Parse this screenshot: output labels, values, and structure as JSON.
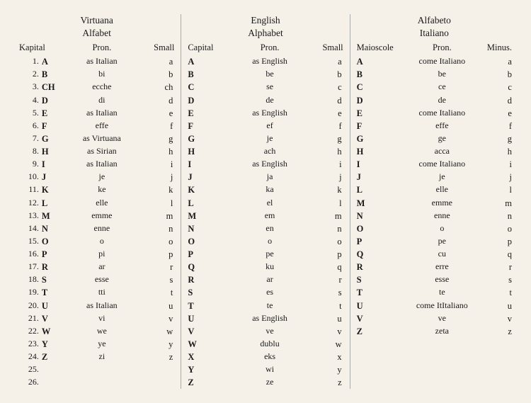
{
  "virtuana": {
    "title1": "Virtuana",
    "title2": "Alfabet",
    "headers": [
      "Kapital",
      "Pron.",
      "Small"
    ],
    "rows": [
      [
        "1.",
        "A",
        "as Italian",
        "a"
      ],
      [
        "2.",
        "B",
        "bi",
        "b"
      ],
      [
        "3.",
        "CH",
        "ecche",
        "ch"
      ],
      [
        "4.",
        "D",
        "di",
        "d"
      ],
      [
        "5.",
        "E",
        "as Italian",
        "e"
      ],
      [
        "6.",
        "F",
        "effe",
        "f"
      ],
      [
        "7.",
        "G",
        "as Virtuana",
        "g"
      ],
      [
        "8.",
        "H",
        "as Sirian",
        "h"
      ],
      [
        "9.",
        "I",
        "as Italian",
        "i"
      ],
      [
        "10.",
        "J",
        "je",
        "j"
      ],
      [
        "11.",
        "K",
        "ke",
        "k"
      ],
      [
        "12.",
        "L",
        "elle",
        "l"
      ],
      [
        "13.",
        "M",
        "emme",
        "m"
      ],
      [
        "14.",
        "N",
        "enne",
        "n"
      ],
      [
        "15.",
        "O",
        "o",
        "o"
      ],
      [
        "16.",
        "P",
        "pi",
        "p"
      ],
      [
        "17.",
        "R",
        "ar",
        "r"
      ],
      [
        "18.",
        "S",
        "esse",
        "s"
      ],
      [
        "19.",
        "T",
        "tti",
        "t"
      ],
      [
        "20.",
        "U",
        "as Italian",
        "u"
      ],
      [
        "21.",
        "V",
        "vi",
        "v"
      ],
      [
        "22.",
        "W",
        "we",
        "w"
      ],
      [
        "23.",
        "Y",
        "ye",
        "y"
      ],
      [
        "24.",
        "Z",
        "zi",
        "z"
      ],
      [
        "25.",
        "",
        "",
        ""
      ],
      [
        "26.",
        "",
        "",
        ""
      ]
    ]
  },
  "english": {
    "title1": "English",
    "title2": "Alphabet",
    "headers": [
      "Capital",
      "Pron.",
      "Small"
    ],
    "rows": [
      [
        "A",
        "as English",
        "a"
      ],
      [
        "B",
        "be",
        "b"
      ],
      [
        "C",
        "se",
        "c"
      ],
      [
        "D",
        "de",
        "d"
      ],
      [
        "E",
        "as English",
        "e"
      ],
      [
        "F",
        "ef",
        "f"
      ],
      [
        "G",
        "je",
        "g"
      ],
      [
        "H",
        "ach",
        "h"
      ],
      [
        "I",
        "as English",
        "i"
      ],
      [
        "J",
        "ja",
        "j"
      ],
      [
        "K",
        "ka",
        "k"
      ],
      [
        "L",
        "el",
        "l"
      ],
      [
        "M",
        "em",
        "m"
      ],
      [
        "N",
        "en",
        "n"
      ],
      [
        "O",
        "o",
        "o"
      ],
      [
        "P",
        "pe",
        "p"
      ],
      [
        "Q",
        "ku",
        "q"
      ],
      [
        "R",
        "ar",
        "r"
      ],
      [
        "S",
        "es",
        "s"
      ],
      [
        "T",
        "te",
        "t"
      ],
      [
        "U",
        "as English",
        "u"
      ],
      [
        "V",
        "ve",
        "v"
      ],
      [
        "W",
        "dublu",
        "w"
      ],
      [
        "X",
        "eks",
        "x"
      ],
      [
        "Y",
        "wi",
        "y"
      ],
      [
        "Z",
        "ze",
        "z"
      ]
    ]
  },
  "italian": {
    "title1": "Alfabeto",
    "title2": "Italiano",
    "headers": [
      "Maioscole",
      "Pron.",
      "Minus."
    ],
    "rows": [
      [
        "A",
        "come Italiano",
        "a"
      ],
      [
        "B",
        "be",
        "b"
      ],
      [
        "C",
        "ce",
        "c"
      ],
      [
        "D",
        "de",
        "d"
      ],
      [
        "E",
        "come Italiano",
        "e"
      ],
      [
        "F",
        "effe",
        "f"
      ],
      [
        "G",
        "ge",
        "g"
      ],
      [
        "H",
        "acca",
        "h"
      ],
      [
        "I",
        "come Italiano",
        "i"
      ],
      [
        "J",
        "je",
        "j"
      ],
      [
        "L",
        "elle",
        "l"
      ],
      [
        "M",
        "emme",
        "m"
      ],
      [
        "N",
        "enne",
        "n"
      ],
      [
        "O",
        "o",
        "o"
      ],
      [
        "P",
        "pe",
        "p"
      ],
      [
        "Q",
        "cu",
        "q"
      ],
      [
        "R",
        "erre",
        "r"
      ],
      [
        "S",
        "esse",
        "s"
      ],
      [
        "T",
        "te",
        "t"
      ],
      [
        "U",
        "come ItItaliano",
        "u"
      ],
      [
        "V",
        "ve",
        "v"
      ],
      [
        "Z",
        "zeta",
        "z"
      ]
    ]
  }
}
